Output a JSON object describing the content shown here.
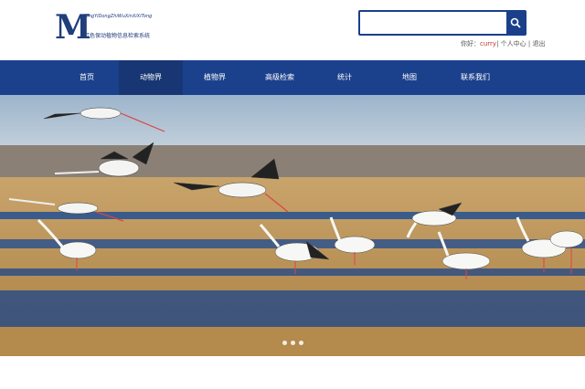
{
  "logo": {
    "mark": "M",
    "english": "XingYiDongZhiWuXinXiXiTong",
    "chinese": "红色保动植物信息检索系统"
  },
  "search": {
    "placeholder": ""
  },
  "user": {
    "greeting": "你好：",
    "name": "curry",
    "links": "| 个人中心 | 退出"
  },
  "nav": [
    "首页",
    "动物界",
    "植物界",
    "高级检索",
    "统计",
    "地图",
    "联系我们"
  ],
  "colors": {
    "nav": "#1c418c",
    "nav_active": "#173673",
    "accent": "#1b3f8a"
  },
  "icons": [
    "search-icon"
  ],
  "banner": {
    "slides": 3,
    "active_slide": 1
  }
}
